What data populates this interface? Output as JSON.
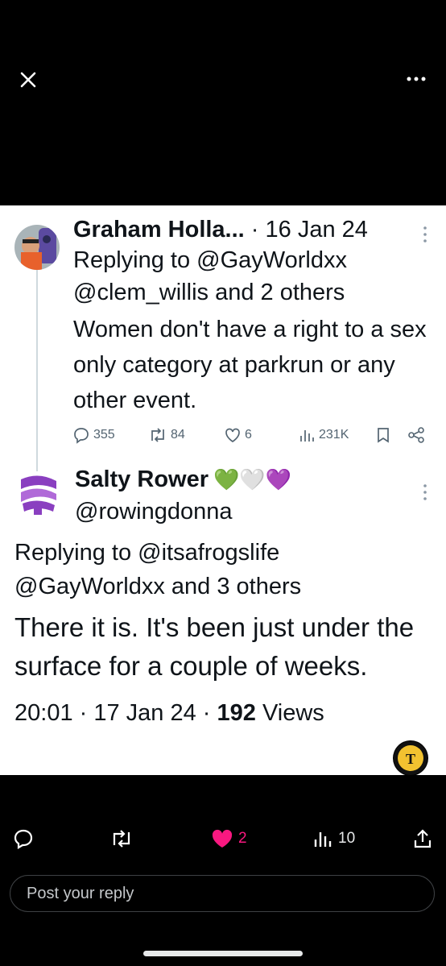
{
  "viewer": {
    "close_icon": "close-icon",
    "more_icon": "more-horizontal-icon"
  },
  "tweet1": {
    "display_name": "Graham Holla...",
    "date": "· 16 Jan 24",
    "replying_to": "Replying to @GayWorldxx",
    "replying_to_others": "@clem_willis and 2 others",
    "text": "Women don't have a right to a sex only category at parkrun or any other event.",
    "replies": "355",
    "reposts": "84",
    "likes": "6",
    "views": "231K"
  },
  "tweet2": {
    "display_name": "Salty Rower",
    "emojis": "💚🤍💜",
    "handle": "@rowingdonna",
    "replying_to": "Replying to @itsafrogslife",
    "replying_to_others": "@GayWorldxx and 3 others",
    "text": "There it is. It's been just under the surface for a couple of weeks.",
    "time": "20:01 · 17 Jan 24 · ",
    "views_count": "192",
    "views_label": " Views"
  },
  "actionbar": {
    "likes": "2",
    "views": "10",
    "like_color": "#f91880"
  },
  "reply": {
    "placeholder": "Post your reply"
  }
}
